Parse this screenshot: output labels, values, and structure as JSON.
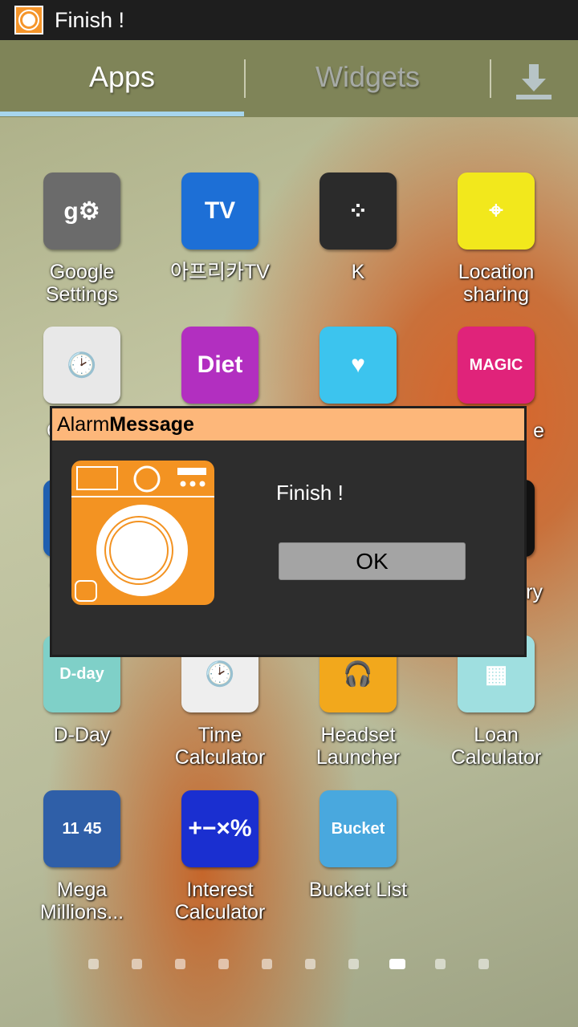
{
  "status": {
    "title": "Finish !",
    "icon": "washing-machine-icon"
  },
  "tabs": {
    "apps": "Apps",
    "widgets": "Widgets",
    "download_icon": "download-icon",
    "active": "Apps"
  },
  "apps": [
    {
      "label": "Google Settings",
      "color": "#6b6b6b",
      "glyph": "g⚙"
    },
    {
      "label": "아프리카TV",
      "color": "#1d6fd6",
      "glyph": "TV"
    },
    {
      "label": "K",
      "color": "#2b2b2b",
      "glyph": "⁘"
    },
    {
      "label": "Location sharing",
      "color": "#f2e81c",
      "glyph": "⌖"
    },
    {
      "label": "Ca",
      "color": "#e8e8e8",
      "glyph": "🕑"
    },
    {
      "label": "",
      "color": "#b22fc0",
      "glyph": "Diet"
    },
    {
      "label": "",
      "color": "#3cc4ee",
      "glyph": "♥"
    },
    {
      "label": "e",
      "color": "#e0237a",
      "glyph": "MAGIC"
    },
    {
      "label": "T",
      "color": "#1f5fb0",
      "glyph": ""
    },
    {
      "label": "",
      "color": "#333",
      "glyph": ""
    },
    {
      "label": "",
      "color": "#333",
      "glyph": ""
    },
    {
      "label": "iary",
      "color": "#111",
      "glyph": ""
    },
    {
      "label": "D-Day",
      "color": "#7fd0c8",
      "glyph": "D-day"
    },
    {
      "label": "Time Calculator",
      "color": "#eeeeee",
      "glyph": "🕑"
    },
    {
      "label": "Headset Launcher",
      "color": "#f2a81c",
      "glyph": "🎧"
    },
    {
      "label": "Loan Calculator",
      "color": "#9fdfe0",
      "glyph": "▦"
    },
    {
      "label": "Mega Millions...",
      "color": "#2f5fa8",
      "glyph": "11 45"
    },
    {
      "label": "Interest Calculator",
      "color": "#1a2fd0",
      "glyph": "+−×%"
    },
    {
      "label": "Bucket List",
      "color": "#49a8de",
      "glyph": "Bucket"
    }
  ],
  "pager": {
    "pages": 10,
    "current": 8
  },
  "dialog": {
    "title_light": "Alarm",
    "title_bold": "Message",
    "message": "Finish !",
    "ok_label": "OK",
    "icon": "washing-machine-icon",
    "accent": "#f39322"
  }
}
